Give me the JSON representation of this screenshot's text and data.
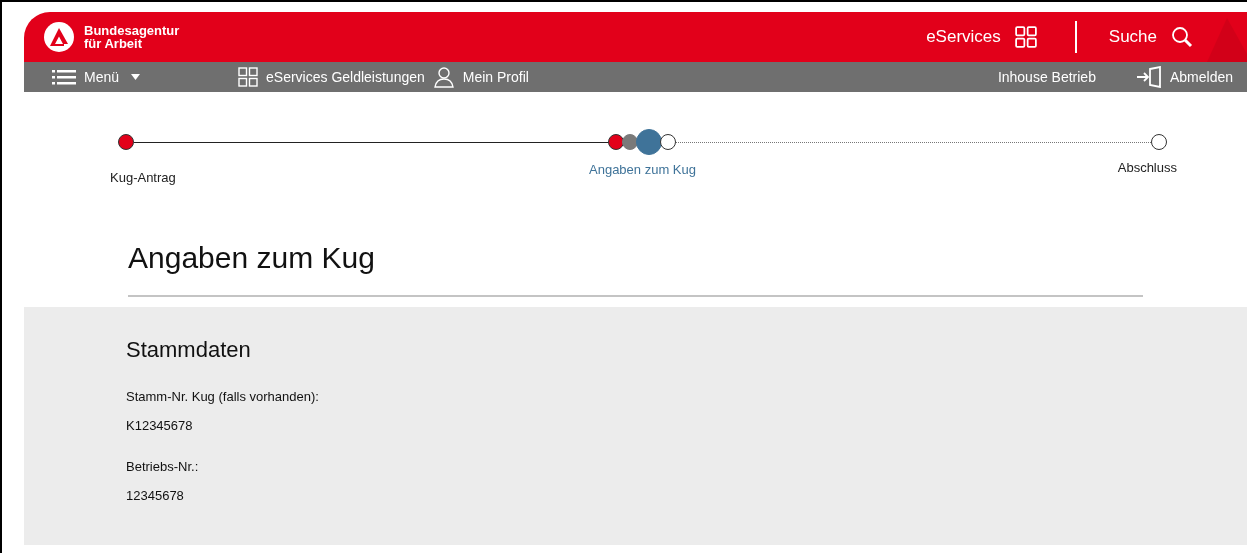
{
  "header": {
    "logo_text": "Bundesagentur\nfür Arbeit",
    "eservices": "eServices",
    "search": "Suche"
  },
  "navbar": {
    "menu": "Menü",
    "links": [
      "eServices Geldleistungen",
      "Mein Profil"
    ],
    "company": "Inhouse Betrieb",
    "logout": "Abmelden"
  },
  "stepper": [
    {
      "label": "Kug-Antrag",
      "completed": true,
      "selected": false
    },
    {
      "label": "Angaben zum Kug",
      "completed": false,
      "selected": true,
      "substeps": [
        {
          "kind": "done"
        },
        {
          "kind": "visited"
        },
        {
          "kind": "current"
        },
        {
          "kind": "open"
        }
      ]
    },
    {
      "label": "Abschluss",
      "completed": false,
      "selected": false
    }
  ],
  "page_title": "Angaben zum Kug",
  "section": {
    "title": "Stammdaten",
    "fields": [
      {
        "label": "Stamm-Nr. Kug (falls vorhanden):",
        "value": "K12345678"
      },
      {
        "label": "Betriebs-Nr.:",
        "value": "12345678"
      }
    ]
  }
}
